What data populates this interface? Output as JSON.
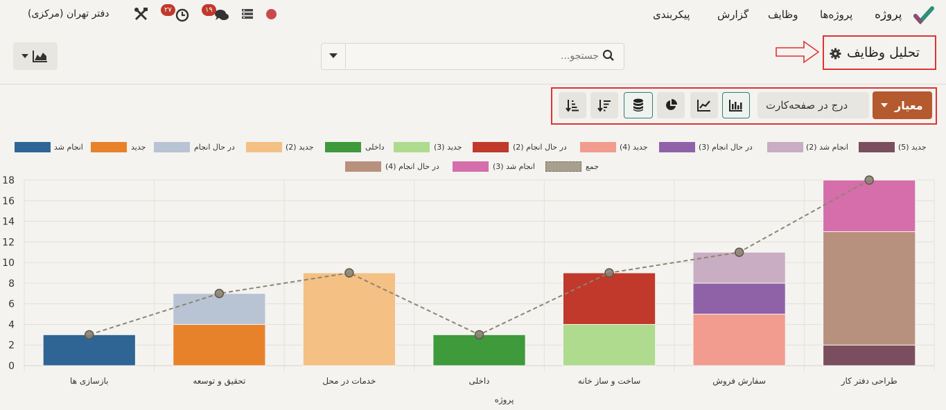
{
  "navbar": {
    "app_name": "پروژه",
    "menu": [
      "پروژه‌ها",
      "وظایف",
      "گزارش",
      "پیکربندی"
    ],
    "company": "دفتر تهران (مرکزی)",
    "activity_badge": "۲۷",
    "messages_badge": "۱۹"
  },
  "page": {
    "title": "تحلیل وظایف",
    "search_placeholder": "جستجو..."
  },
  "toolbar": {
    "measure_label": "معیار",
    "insert_dashboard_label": "درج در صفحه‌کارت"
  },
  "colors": {
    "primary": "#b55a2e",
    "teal": "#2f7d6f",
    "highlight": "#dd3333"
  },
  "chart_data": {
    "type": "bar",
    "stacked": true,
    "xlabel": "پروژه",
    "ylim": [
      0,
      18
    ],
    "yticks": [
      0,
      2,
      4,
      6,
      8,
      10,
      12,
      14,
      16,
      18
    ],
    "grid": true,
    "legend_position": "top",
    "categories": [
      "طراحی دفتر کار",
      "سفارش فروش",
      "ساخت و ساز خانه",
      "داخلی",
      "خدمات در محل",
      "تحقیق و توسعه",
      "بازسازی ها"
    ],
    "series": [
      {
        "name": "جدید (5)",
        "color": "#7b4e5f",
        "values": [
          2,
          0,
          0,
          0,
          0,
          0,
          0
        ]
      },
      {
        "name": "انجام شد (2)",
        "color": "#c9adc2",
        "values": [
          0,
          3,
          0,
          0,
          0,
          0,
          0
        ]
      },
      {
        "name": "در حال انجام (3)",
        "color": "#8f62a8",
        "values": [
          0,
          3,
          0,
          0,
          0,
          0,
          0
        ]
      },
      {
        "name": "جدید (4)",
        "color": "#f19c8e",
        "values": [
          0,
          5,
          0,
          0,
          0,
          0,
          0
        ]
      },
      {
        "name": "در حال انجام (2)",
        "color": "#c0392b",
        "values": [
          0,
          0,
          5,
          0,
          0,
          0,
          0
        ]
      },
      {
        "name": "جدید (3)",
        "color": "#aedb8e",
        "values": [
          0,
          0,
          4,
          0,
          0,
          0,
          0
        ]
      },
      {
        "name": "داخلی",
        "color": "#3e9a3a",
        "values": [
          0,
          0,
          0,
          3,
          0,
          0,
          0
        ]
      },
      {
        "name": "جدید (2)",
        "color": "#f4c084",
        "values": [
          0,
          0,
          0,
          0,
          9,
          0,
          0
        ]
      },
      {
        "name": "در حال انجام",
        "color": "#b8c3d3",
        "values": [
          0,
          0,
          0,
          0,
          0,
          3,
          0
        ]
      },
      {
        "name": "جدید",
        "color": "#e8822a",
        "values": [
          0,
          0,
          0,
          0,
          0,
          4,
          0
        ]
      },
      {
        "name": "انجام شد",
        "color": "#2f6594",
        "values": [
          0,
          0,
          0,
          0,
          0,
          0,
          3
        ]
      },
      {
        "name": "در حال انجام (4)",
        "color": "#b8907e",
        "values": [
          11,
          0,
          0,
          0,
          0,
          0,
          0
        ]
      },
      {
        "name": "انجام شد (3)",
        "color": "#d56eaa",
        "values": [
          5,
          0,
          0,
          0,
          0,
          0,
          0
        ]
      }
    ],
    "total_series": {
      "name": "جمع",
      "color": "#8c8473",
      "values": [
        18,
        11,
        9,
        3,
        9,
        7,
        3
      ]
    }
  }
}
